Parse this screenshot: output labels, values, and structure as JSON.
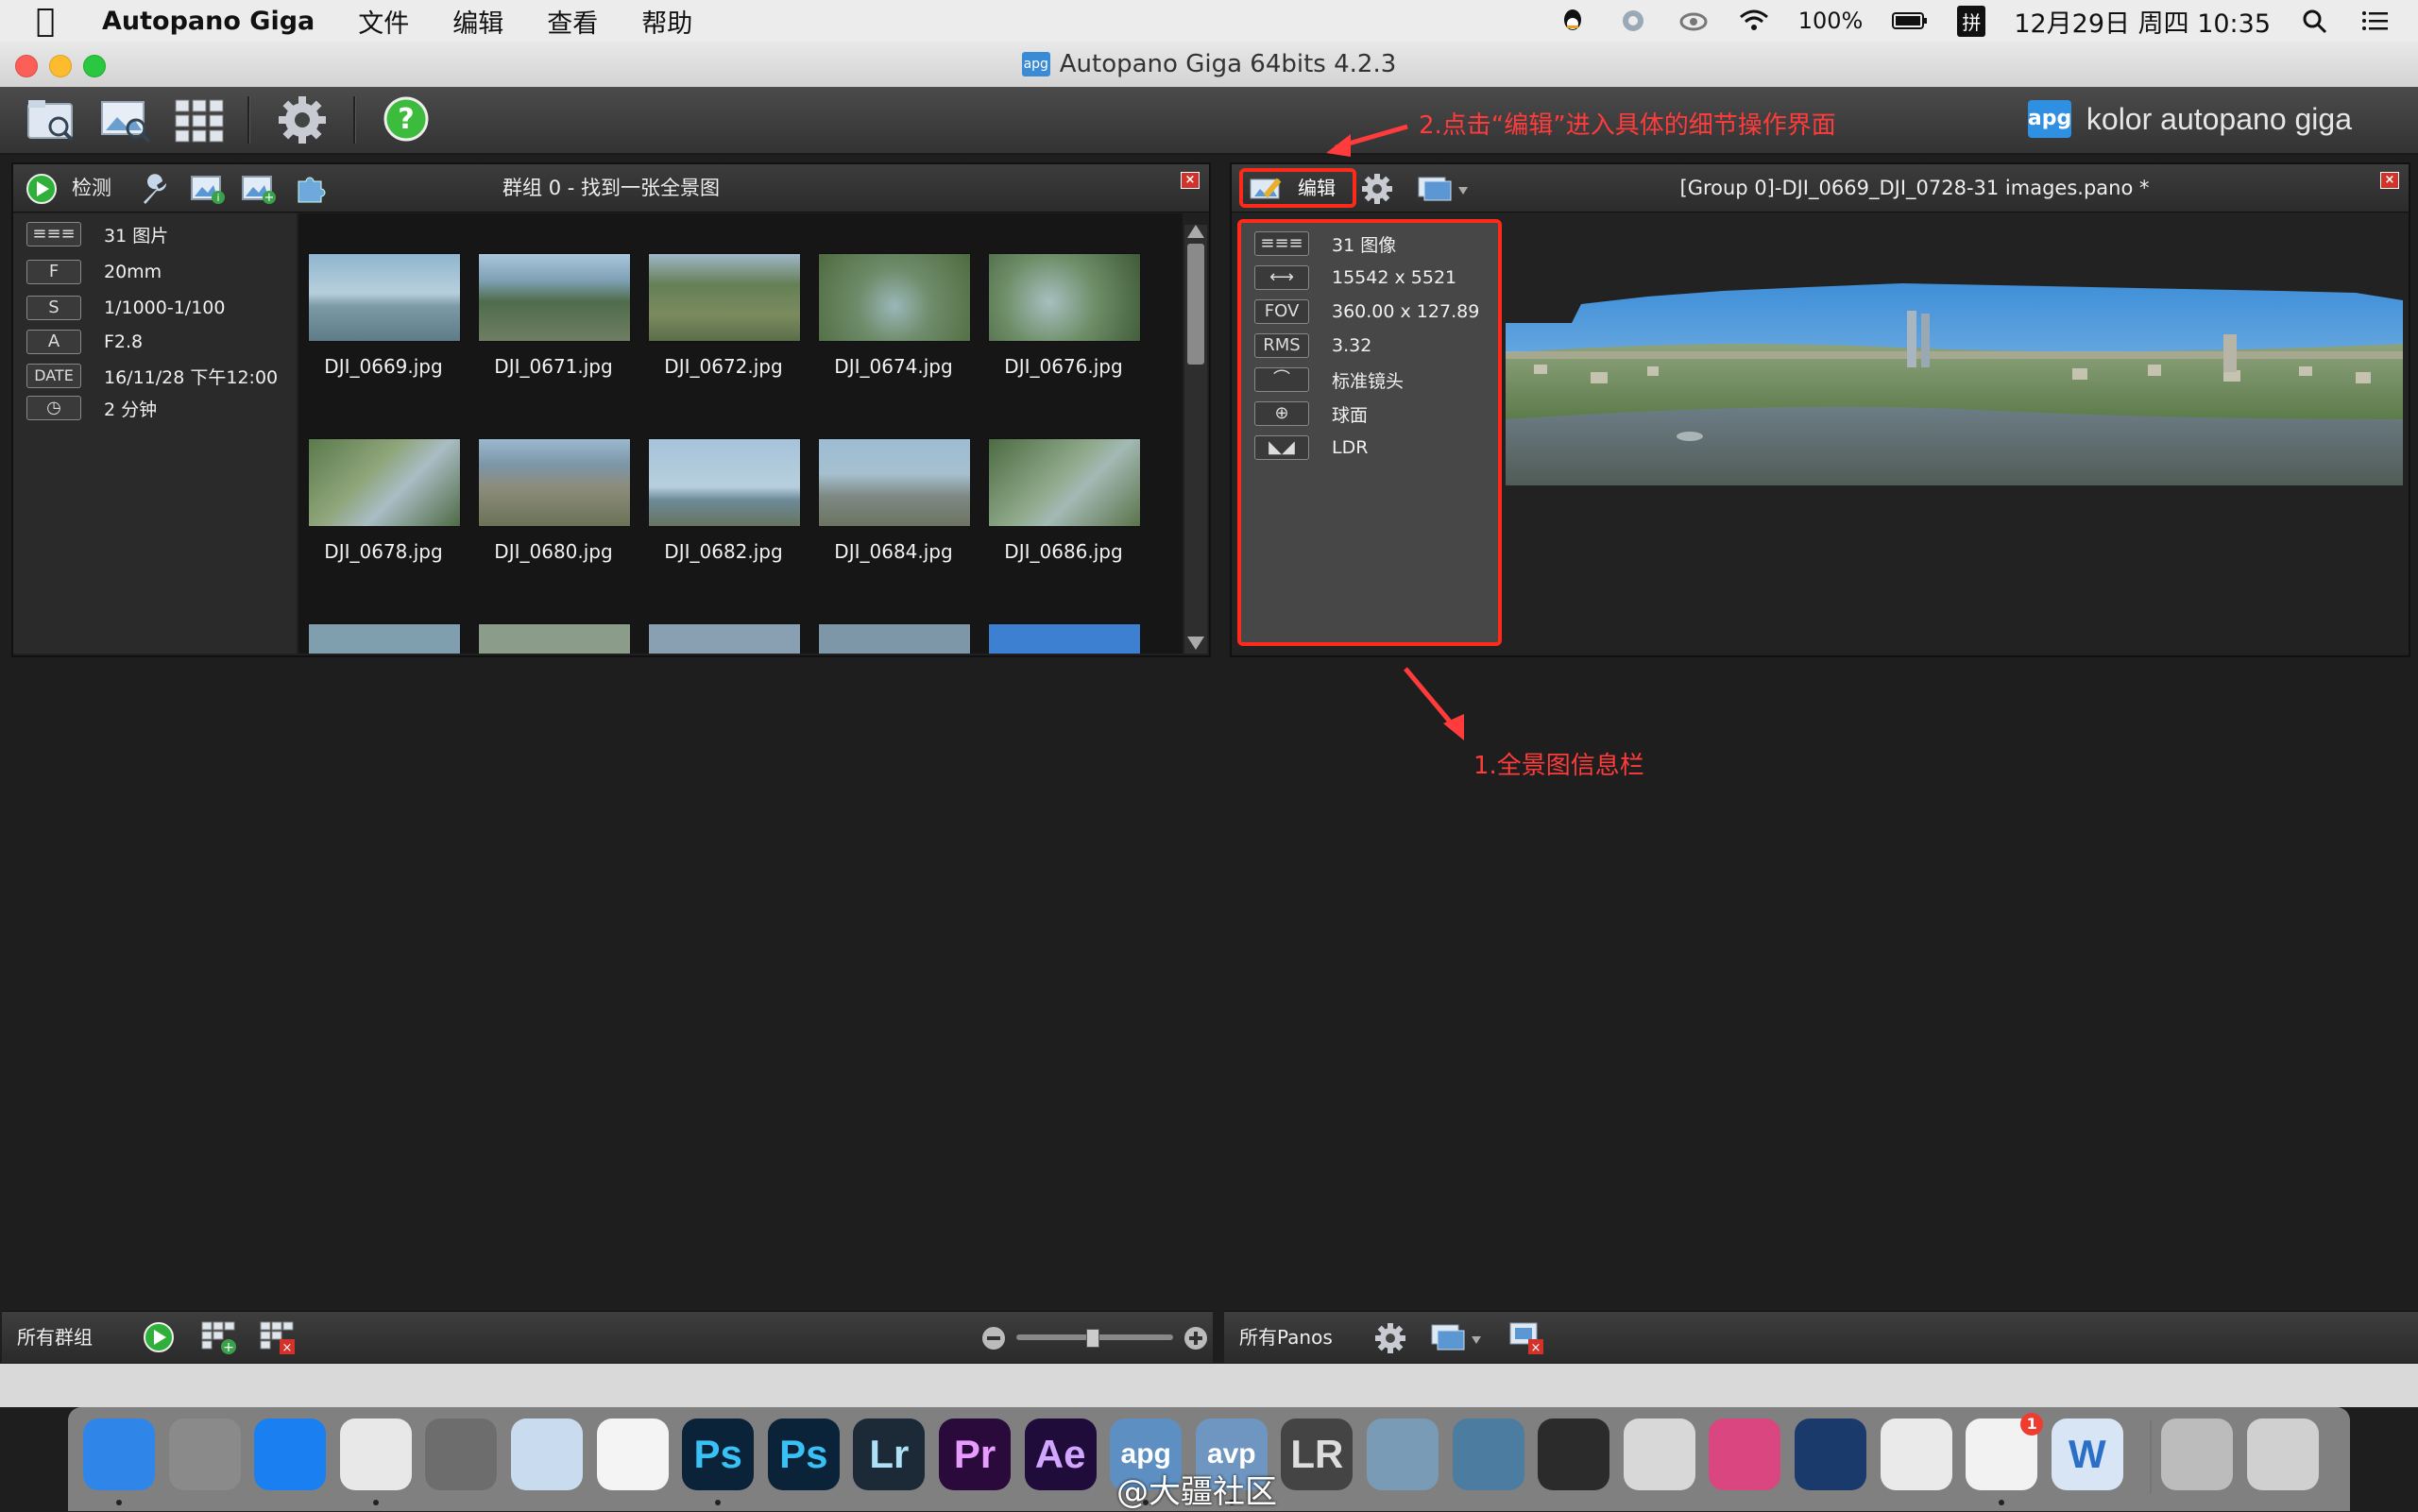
{
  "menubar": {
    "app_name": "Autopano Giga",
    "menus": [
      "文件",
      "编辑",
      "查看",
      "帮助"
    ],
    "battery": "100%",
    "input_method": "拼",
    "clock": "12月29日 周四  10:35"
  },
  "window": {
    "title": "Autopano Giga 64bits 4.2.3",
    "title_icon": "apg"
  },
  "brand": {
    "logo": "apg",
    "text": "kolor autopano giga"
  },
  "left_panel": {
    "detect_label": "检测",
    "title": "群组 0 - 找到一张全景图",
    "info": [
      {
        "key": "≡≡≡",
        "value": "31 图片"
      },
      {
        "key": "F",
        "value": "20mm"
      },
      {
        "key": "S",
        "value": "1/1000-1/100"
      },
      {
        "key": "A",
        "value": "F2.8"
      },
      {
        "key": "DATE",
        "value": "16/11/28 下午12:00"
      },
      {
        "key": "◷",
        "value": "2 分钟"
      }
    ],
    "thumbnails": [
      "DJI_0669.jpg",
      "DJI_0671.jpg",
      "DJI_0672.jpg",
      "DJI_0674.jpg",
      "DJI_0676.jpg",
      "DJI_0678.jpg",
      "DJI_0680.jpg",
      "DJI_0682.jpg",
      "DJI_0684.jpg",
      "DJI_0686.jpg"
    ],
    "footer_label": "所有群组"
  },
  "right_panel": {
    "edit_label": "编辑",
    "title": "[Group 0]-DJI_0669_DJI_0728-31 images.pano *",
    "info": [
      {
        "key": "≡≡≡",
        "value": "31 图像"
      },
      {
        "key": "⟷",
        "value": "15542 x 5521"
      },
      {
        "key": "FOV",
        "value": "360.00 x 127.89"
      },
      {
        "key": "RMS",
        "value": "3.32"
      },
      {
        "key": "⌒",
        "value": "标准镜头"
      },
      {
        "key": "⊕",
        "value": "球面"
      },
      {
        "key": "◣◢",
        "value": "LDR"
      }
    ],
    "footer_label": "所有Panos"
  },
  "annotations": {
    "edit_hint": "2.点击“编辑”进入具体的细节操作界面",
    "info_hint": "1.全景图信息栏"
  },
  "dock": {
    "apps": [
      {
        "name": "finder-icon",
        "label": "",
        "bg": "#2f86e8",
        "fg": "#fff"
      },
      {
        "name": "launchpad-icon",
        "label": "",
        "bg": "#8a8a8a",
        "fg": "#fff"
      },
      {
        "name": "safari-icon",
        "label": "",
        "bg": "#1a7ff0",
        "fg": "#fff"
      },
      {
        "name": "chrome-icon",
        "label": "",
        "bg": "#e8e8e8",
        "fg": "#fff"
      },
      {
        "name": "system-preferences-icon",
        "label": "",
        "bg": "#6d6d6d",
        "fg": "#fff"
      },
      {
        "name": "preview-icon",
        "label": "",
        "bg": "#c9dbef",
        "fg": "#333"
      },
      {
        "name": "photos-icon",
        "label": "",
        "bg": "#f4f4f4",
        "fg": "#e44"
      },
      {
        "name": "photoshop-icon",
        "label": "Ps",
        "bg": "#0b2338",
        "fg": "#39c0f5"
      },
      {
        "name": "photoshop-2-icon",
        "label": "Ps",
        "bg": "#0b2338",
        "fg": "#39c0f5"
      },
      {
        "name": "lightroom-icon",
        "label": "Lr",
        "bg": "#1b2a36",
        "fg": "#aee0f7"
      },
      {
        "name": "premiere-icon",
        "label": "Pr",
        "bg": "#2a0a3a",
        "fg": "#e89cff"
      },
      {
        "name": "after-effects-icon",
        "label": "Ae",
        "bg": "#1f0c3a",
        "fg": "#d2a6ff"
      },
      {
        "name": "autopano-giga-icon",
        "label": "apg",
        "bg": "#5d8fc2",
        "fg": "#fff"
      },
      {
        "name": "autopano-video-icon",
        "label": "avp",
        "bg": "#6f96c0",
        "fg": "#fff"
      },
      {
        "name": "lrtimelapse-icon",
        "label": "LR",
        "bg": "#444",
        "fg": "#ddd"
      },
      {
        "name": "photo-app-icon",
        "label": "",
        "bg": "#7a9bb5",
        "fg": "#fff"
      },
      {
        "name": "sketchup-icon",
        "label": "",
        "bg": "#4c7da0",
        "fg": "#fff"
      },
      {
        "name": "final-cut-icon",
        "label": "",
        "bg": "#2b2b2b",
        "fg": "#fff"
      },
      {
        "name": "compressor-icon",
        "label": "",
        "bg": "#d8d8d8",
        "fg": "#333"
      },
      {
        "name": "davinci-icon",
        "label": "",
        "bg": "#d94680",
        "fg": "#fff"
      },
      {
        "name": "quicktime-icon",
        "label": "",
        "bg": "#1a3a6b",
        "fg": "#fff"
      },
      {
        "name": "wechat-icon",
        "label": "",
        "bg": "#eaeaea",
        "fg": "#3a3"
      },
      {
        "name": "qq-icon",
        "label": "",
        "bg": "#f2f2f2",
        "fg": "#111"
      },
      {
        "name": "word-icon",
        "label": "W",
        "bg": "#d7e5f5",
        "fg": "#2b6fc6"
      },
      {
        "name": "documents-folder-icon",
        "label": "",
        "bg": "#bcbcbc",
        "fg": "#fff"
      },
      {
        "name": "trash-icon",
        "label": "",
        "bg": "#d0d0d0",
        "fg": "#fff"
      }
    ],
    "qq_badge": "1",
    "watermark": "@大疆社区"
  },
  "colors": {
    "annotation_red": "#ff3b3b",
    "accent_blue": "#2f8fe0"
  }
}
